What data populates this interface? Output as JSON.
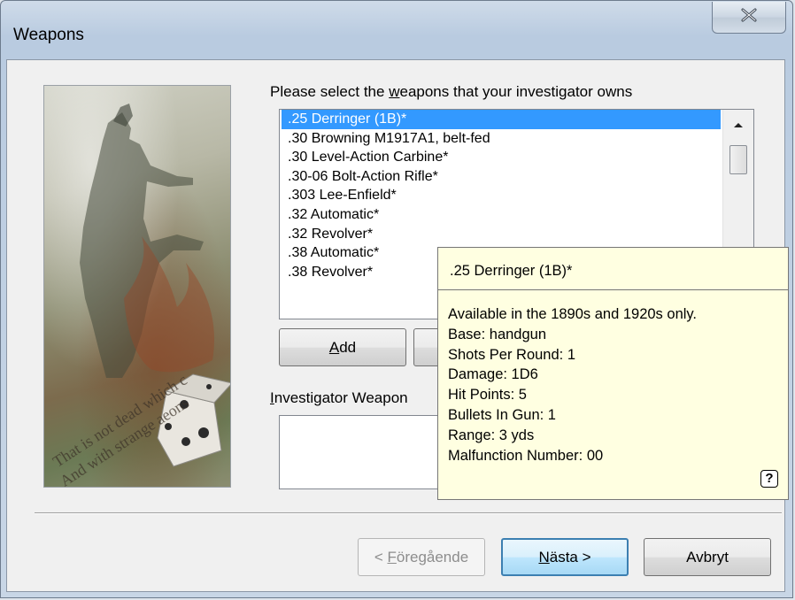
{
  "window": {
    "title": "Weapons",
    "close_symbol": "X"
  },
  "picture": {
    "quote_line1": "That is not dead which c",
    "quote_line2": "And with strange aeons"
  },
  "prompt": {
    "before": "Please select the ",
    "accent": "w",
    "after": "eapons that your investigator owns"
  },
  "weapons_list": {
    "items": [
      ".25 Derringer (1B)*",
      ".30 Browning M1917A1, belt-fed",
      ".30 Level-Action Carbine*",
      ".30-06 Bolt-Action Rifle*",
      ".303 Lee-Enfield*",
      ".32 Automatic*",
      ".32 Revolver*",
      ".38 Automatic*",
      ".38 Revolver*"
    ],
    "selected_index": 0
  },
  "buttons": {
    "add_accent": "A",
    "add_rest": "dd",
    "prev_prefix": "< ",
    "prev_accent": "F",
    "prev_rest": "öregående",
    "next_accent": "N",
    "next_rest": "ästa >",
    "cancel": "Avbryt"
  },
  "investigator_weapons": {
    "label_accent": "I",
    "label_rest": "nvestigator Weapon"
  },
  "tooltip": {
    "title": ".25 Derringer (1B)*",
    "lines": [
      "Available in the 1890s and 1920s only.",
      "Base: handgun",
      "Shots Per Round: 1",
      "Damage: 1D6",
      "Hit Points: 5",
      "Bullets In Gun: 1",
      "Range: 3 yds",
      "Malfunction Number: 00"
    ],
    "help_symbol": "?"
  },
  "icons": {
    "close": "close-icon",
    "scroll_up": "chevron-up-icon",
    "help": "help-icon"
  },
  "colors": {
    "selection": "#3399ff",
    "tooltip_bg": "#ffffe1",
    "default_button_border": "#3c7fb1"
  }
}
